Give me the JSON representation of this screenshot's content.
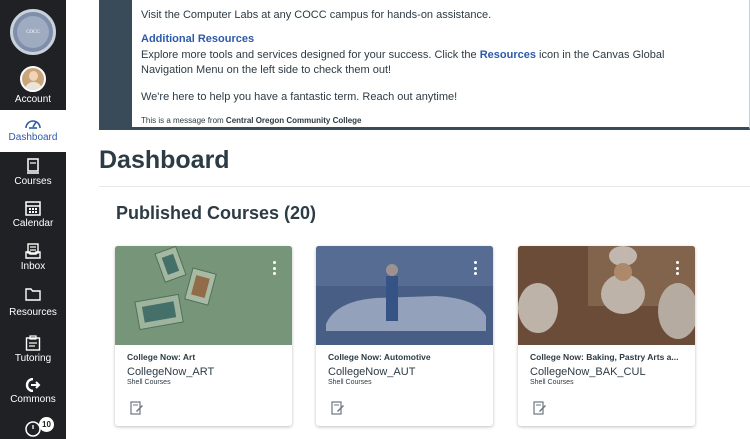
{
  "nav": {
    "logo_text": "COCC",
    "items": [
      {
        "label": "Account",
        "icon": "avatar"
      },
      {
        "label": "Dashboard",
        "icon": "dashboard-gauge-icon"
      },
      {
        "label": "Courses",
        "icon": "book-icon"
      },
      {
        "label": "Calendar",
        "icon": "calendar-icon"
      },
      {
        "label": "Inbox",
        "icon": "inbox-icon"
      },
      {
        "label": "Resources",
        "icon": "folder-icon"
      },
      {
        "label": "Tutoring",
        "icon": "clipboard-icon"
      },
      {
        "label": "Commons",
        "icon": "commons-arrow-icon"
      }
    ],
    "history_badge": "10"
  },
  "announcement": {
    "line1": "Visit the Computer Labs at any COCC campus for hands-on assistance.",
    "heading": "Additional Resources",
    "body_before": "Explore more tools and services designed for your success. Click the ",
    "body_link": "Resources",
    "body_after": " icon in the Canvas Global Navigation Menu on the left side to check them out!",
    "closing": "We're here to help you have a fantastic term. Reach out anytime!",
    "from_prefix": "This is a message from ",
    "from_org": "Central Oregon Community College"
  },
  "page_title": "Dashboard",
  "section_title": "Published Courses (20)",
  "courses": [
    {
      "title": "College Now: Art",
      "code": "CollegeNow_ART",
      "term": "Shell Courses"
    },
    {
      "title": "College Now: Automotive",
      "code": "CollegeNow_AUT",
      "term": "Shell Courses"
    },
    {
      "title": "College Now: Baking, Pastry Arts a...",
      "code": "CollegeNow_BAK_CUL",
      "term": "Shell Courses"
    }
  ],
  "colors": {
    "nav_bg": "#202124",
    "accent": "#2d5aa8",
    "announcement_bar": "#394b58"
  }
}
